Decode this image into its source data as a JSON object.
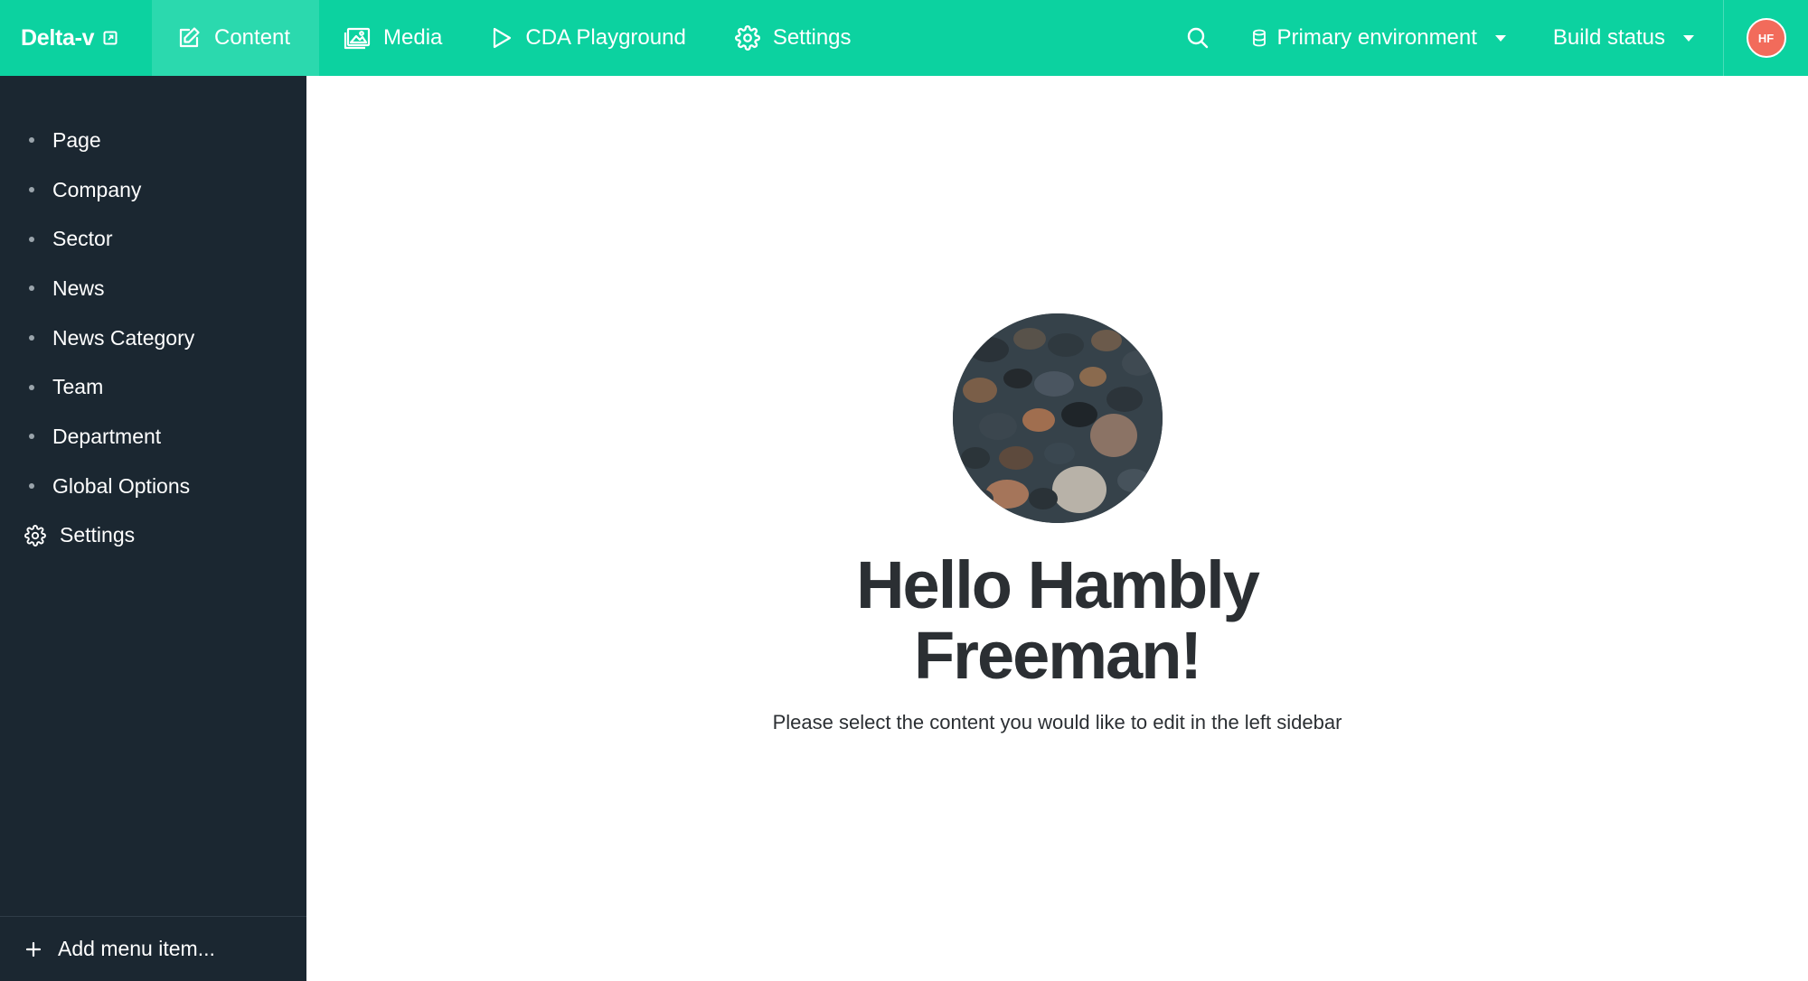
{
  "topbar": {
    "brand": "Delta-v",
    "nav": [
      {
        "label": "Content",
        "icon": "edit-icon"
      },
      {
        "label": "Media",
        "icon": "image-icon"
      },
      {
        "label": "CDA Playground",
        "icon": "play-icon"
      },
      {
        "label": "Settings",
        "icon": "gear-icon"
      }
    ],
    "environment_label": "Primary environment",
    "build_status_label": "Build status",
    "avatar_initials": "HF",
    "accent_color": "#0cd2a0",
    "avatar_color": "#f26b5b"
  },
  "sidebar": {
    "items": [
      {
        "label": "Page"
      },
      {
        "label": "Company"
      },
      {
        "label": "Sector"
      },
      {
        "label": "News"
      },
      {
        "label": "News Category"
      },
      {
        "label": "Team"
      },
      {
        "label": "Department"
      },
      {
        "label": "Global Options"
      }
    ],
    "settings_label": "Settings",
    "add_label": "Add menu item...",
    "background_color": "#1b2731"
  },
  "main": {
    "greeting": "Hello Hambly Freeman!",
    "subtitle": "Please select the content you would like to edit in the left sidebar",
    "image": "pebbles-photo"
  }
}
